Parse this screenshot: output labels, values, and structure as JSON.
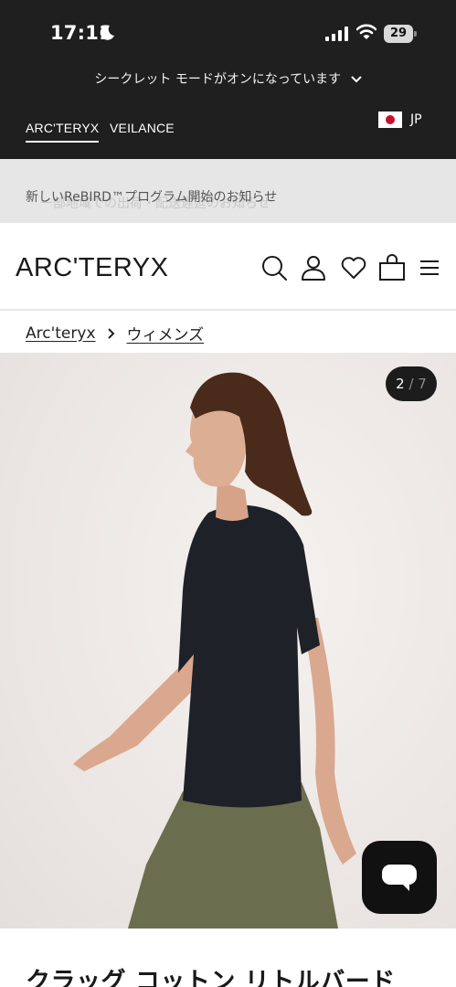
{
  "status_bar": {
    "time": "17:11",
    "battery": "29"
  },
  "private_banner": {
    "text": "シークレット モードがオンになっています"
  },
  "brand_bar": {
    "tabs": [
      {
        "label": "ARC'TERYX"
      },
      {
        "label": "VEILANCE"
      }
    ],
    "locale": "JP"
  },
  "announcement": {
    "text": "新しいReBIRD™プログラム開始のお知らせ",
    "ghost_text": "一部地域での出荷・配送遅延のお知らせ"
  },
  "header": {
    "logo": "ARC'TERYX"
  },
  "breadcrumb": {
    "items": [
      "Arc'teryx",
      "ウィメンズ"
    ]
  },
  "gallery": {
    "current": "2",
    "separator": " / ",
    "total": "7"
  },
  "product": {
    "title": "クラッグ コットン リトルバード"
  },
  "icons": [
    "moon-icon",
    "signal-icon",
    "wifi-icon",
    "battery-icon",
    "chevron-down-icon",
    "search-icon",
    "account-icon",
    "heart-icon",
    "cart-icon",
    "menu-icon",
    "chevron-right-icon",
    "chat-icon"
  ],
  "colors": {
    "topbar": "#1f1f1f",
    "announce_bg": "#e6e6e6",
    "counter_bg": "#1c1c1c",
    "chat_bg": "#111111"
  }
}
